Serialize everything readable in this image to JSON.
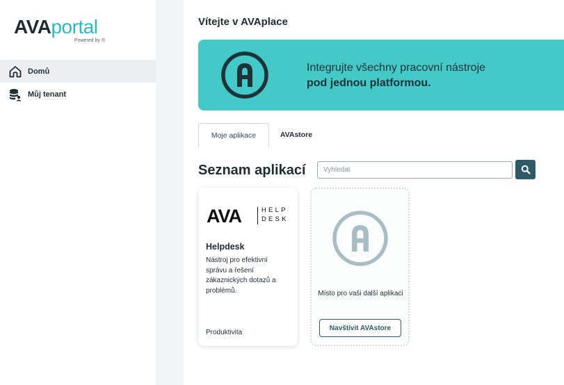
{
  "app": {
    "logo_bold": "AVA",
    "logo_light": "portal",
    "logo_sub": "Powered by ®"
  },
  "sidebar": {
    "items": [
      {
        "label": "Domů",
        "icon": "home-icon",
        "active": true
      },
      {
        "label": "Můj tenant",
        "icon": "database-user-icon",
        "active": false
      }
    ]
  },
  "main": {
    "title": "Vítejte v AVAplace",
    "banner": {
      "line1": "Integrujte všechny pracovní nástroje",
      "line2": "pod jednou platformou."
    },
    "tabs": [
      {
        "label": "Moje aplikace",
        "active": true
      },
      {
        "label": "AVAstore",
        "active": false
      }
    ],
    "section_title": "Seznam aplikací",
    "search": {
      "placeholder": "Vyhledat",
      "value": ""
    },
    "cards": {
      "helpdesk": {
        "logo_wordmark": "AVA",
        "logo_tag_line1": "HELP",
        "logo_tag_line2": "DESK",
        "title": "Helpdesk",
        "description": "Nástroj pro efektivní správu a řešení zákaznických dotazů a problémů.",
        "category": "Produktivita"
      },
      "placeholder": {
        "text": "Místo pro vaši další aplikaci",
        "button": "Navštívit AVAstore"
      }
    }
  },
  "colors": {
    "accent": "#45c8c8",
    "brand_dark": "#2d5a66",
    "text": "#1f2d33",
    "sidebar_active": "#eceeef"
  }
}
